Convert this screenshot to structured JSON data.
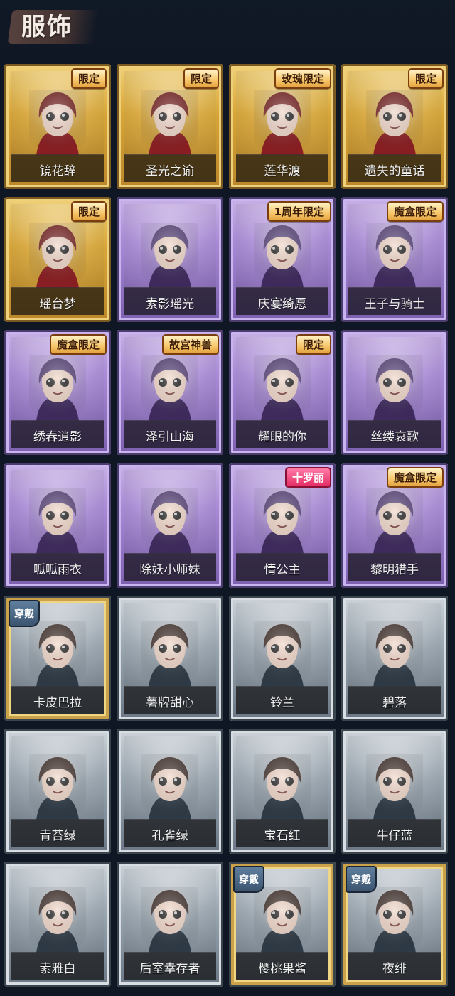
{
  "page": {
    "title": "服饰"
  },
  "cards": [
    {
      "name": "镜花辞",
      "badge": "限定",
      "rarity": "gold",
      "wearing": false
    },
    {
      "name": "圣光之谕",
      "badge": "限定",
      "rarity": "gold",
      "wearing": false
    },
    {
      "name": "莲华渡",
      "badge": "玫瑰限定",
      "rarity": "gold",
      "wearing": false
    },
    {
      "name": "遗失的童话",
      "badge": "限定",
      "rarity": "gold",
      "wearing": false
    },
    {
      "name": "瑶台梦",
      "badge": "限定",
      "rarity": "gold",
      "wearing": false
    },
    {
      "name": "素影瑶光",
      "badge": "",
      "rarity": "purple",
      "wearing": false
    },
    {
      "name": "庆宴绮愿",
      "badge": "1周年限定",
      "rarity": "purple",
      "wearing": false
    },
    {
      "name": "王子与骑士",
      "badge": "魔盒限定",
      "rarity": "purple",
      "wearing": false
    },
    {
      "name": "绣春逍影",
      "badge": "魔盒限定",
      "rarity": "purple",
      "wearing": false
    },
    {
      "name": "泽引山海",
      "badge": "故宫神兽",
      "rarity": "purple",
      "wearing": false
    },
    {
      "name": "耀眼的你",
      "badge": "限定",
      "rarity": "purple",
      "wearing": false
    },
    {
      "name": "丝缕哀歌",
      "badge": "",
      "rarity": "purple",
      "wearing": false
    },
    {
      "name": "呱呱雨衣",
      "badge": "",
      "rarity": "purple",
      "wearing": false
    },
    {
      "name": "除妖小师妹",
      "badge": "",
      "rarity": "purple",
      "wearing": false
    },
    {
      "name": "情公主",
      "badge": "十罗丽",
      "rarity": "purple",
      "wearing": false
    },
    {
      "name": "黎明猎手",
      "badge": "魔盒限定",
      "rarity": "purple",
      "wearing": false
    },
    {
      "name": "卡皮巴拉",
      "badge": "",
      "rarity": "gray",
      "wearing": true
    },
    {
      "name": "薯牌甜心",
      "badge": "",
      "rarity": "gray",
      "wearing": false
    },
    {
      "name": "铃兰",
      "badge": "",
      "rarity": "gray",
      "wearing": false
    },
    {
      "name": "碧落",
      "badge": "",
      "rarity": "gray",
      "wearing": false
    },
    {
      "name": "青苔绿",
      "badge": "",
      "rarity": "gray",
      "wearing": false
    },
    {
      "name": "孔雀绿",
      "badge": "",
      "rarity": "gray",
      "wearing": false
    },
    {
      "name": "宝石红",
      "badge": "",
      "rarity": "gray",
      "wearing": false
    },
    {
      "name": "牛仔蓝",
      "badge": "",
      "rarity": "gray",
      "wearing": false
    },
    {
      "name": "素雅白",
      "badge": "",
      "rarity": "gray",
      "wearing": false
    },
    {
      "name": "后室幸存者",
      "badge": "",
      "rarity": "gray",
      "wearing": false
    },
    {
      "name": "樱桃果酱",
      "badge": "",
      "rarity": "gray",
      "wearing": true
    },
    {
      "name": "夜绯",
      "badge": "",
      "rarity": "gray",
      "wearing": true
    }
  ],
  "wear_label": "穿戴"
}
